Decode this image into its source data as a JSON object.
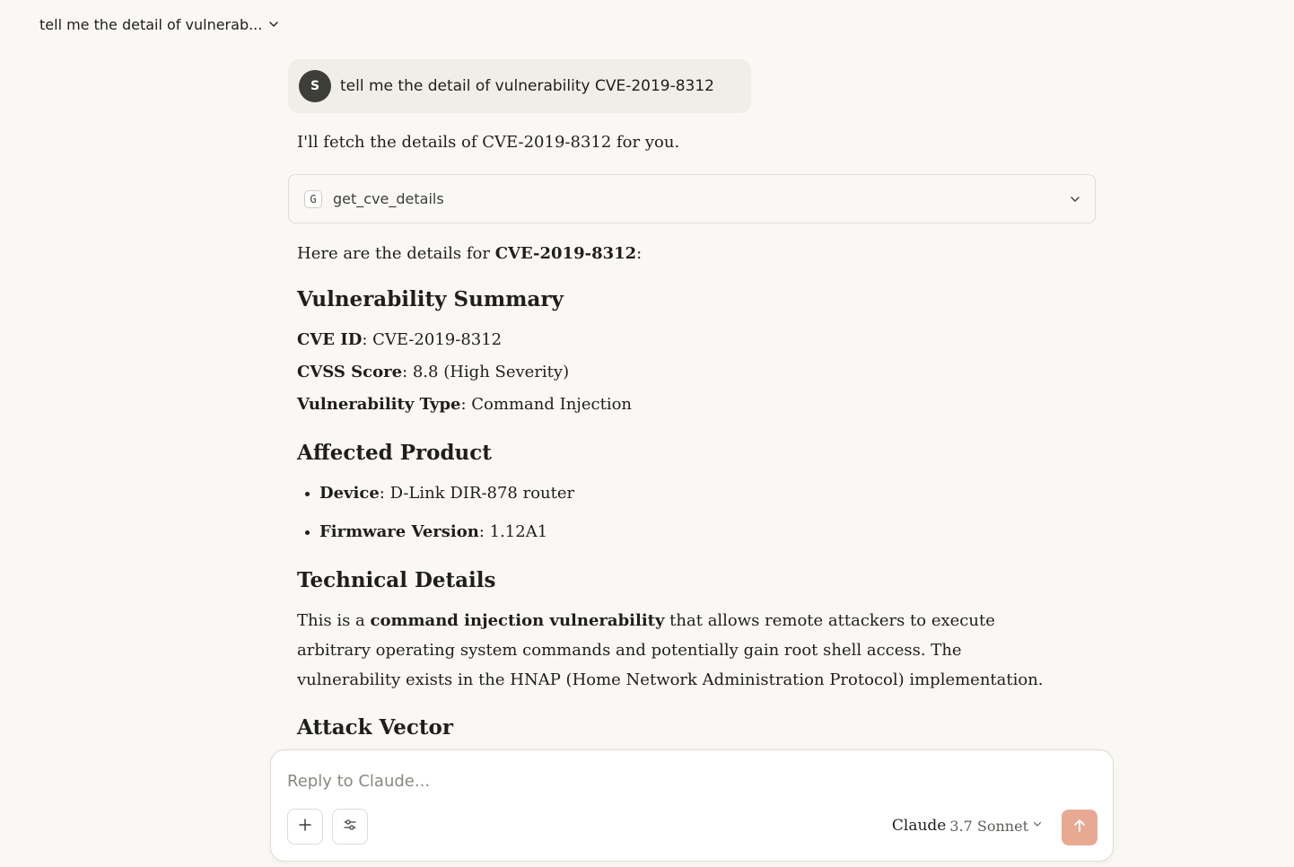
{
  "header": {
    "conversation_title": "tell me the detail of vulnerab..."
  },
  "user_message": {
    "avatar_initial": "S",
    "text": "tell me the detail of vulnerability CVE-2019-8312"
  },
  "assistant": {
    "intro": "I'll fetch the details of CVE-2019-8312 for you.",
    "tool_call": {
      "icon_letter": "G",
      "name": "get_cve_details"
    },
    "lead_prefix": "Here are the details for ",
    "lead_cve": "CVE-2019-8312",
    "lead_suffix": ":",
    "sections": {
      "summary_heading": "Vulnerability Summary",
      "summary_items": [
        {
          "label": "CVE ID",
          "value": ": CVE-2019-8312"
        },
        {
          "label": "CVSS Score",
          "value": ": 8.8 (High Severity)"
        },
        {
          "label": "Vulnerability Type",
          "value": ": Command Injection"
        }
      ],
      "product_heading": "Affected Product",
      "product_items": [
        {
          "label": "Device",
          "value": ": D-Link DIR-878 router"
        },
        {
          "label": "Firmware Version",
          "value": ": 1.12A1"
        }
      ],
      "tech_heading": "Technical Details",
      "tech_prefix": "This is a ",
      "tech_bold": "command injection vulnerability",
      "tech_rest": " that allows remote attackers to execute arbitrary operating system commands and potentially gain root shell access. The vulnerability exists in the HNAP (Home Network Administration Protocol) implementation.",
      "attack_heading": "Attack Vector"
    }
  },
  "composer": {
    "placeholder": "Reply to Claude...",
    "model_name": "Claude",
    "model_version": "3.7 Sonnet",
    "send_color": "#e8a992"
  }
}
